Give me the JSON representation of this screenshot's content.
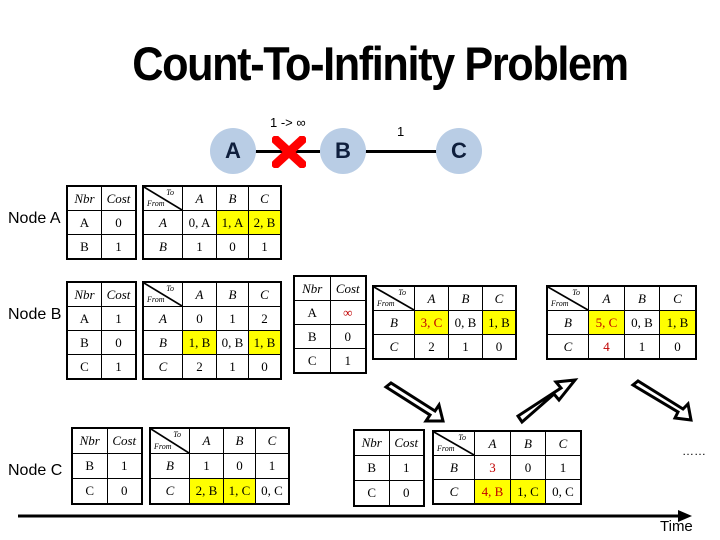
{
  "title": "Count-To-Infinity Problem",
  "topology": {
    "nodes": [
      {
        "id": "A",
        "label": "A"
      },
      {
        "id": "B",
        "label": "B"
      },
      {
        "id": "C",
        "label": "C"
      }
    ],
    "edges": [
      {
        "from": "A",
        "to": "B",
        "label": "1 -> ∞",
        "broken": true
      },
      {
        "from": "B",
        "to": "C",
        "label": "1",
        "broken": false
      }
    ],
    "node_color": "#b9cde5",
    "break_color": "#ff0000"
  },
  "node_labels": {
    "a": "Node A",
    "b": "Node B",
    "c": "Node C"
  },
  "table_headers": {
    "nbr": "Nbr",
    "cost": "Cost",
    "to": "To",
    "from": "From",
    "cols": [
      "A",
      "B",
      "C"
    ]
  },
  "tables": {
    "a1": {
      "nbr": [
        [
          "A",
          "0"
        ],
        [
          "B",
          "1"
        ]
      ],
      "dv": [
        {
          "from": "A",
          "cells": [
            {
              "v": "0, A"
            },
            {
              "v": "1, A",
              "hl": true
            },
            {
              "v": "2, B",
              "hl": true
            }
          ]
        },
        {
          "from": "B",
          "cells": [
            {
              "v": "1"
            },
            {
              "v": "0"
            },
            {
              "v": "1"
            }
          ]
        }
      ]
    },
    "b1": {
      "nbr": [
        [
          "A",
          "1"
        ],
        [
          "B",
          "0"
        ],
        [
          "C",
          "1"
        ]
      ],
      "dv": [
        {
          "from": "A",
          "cells": [
            {
              "v": "0"
            },
            {
              "v": "1"
            },
            {
              "v": "2"
            }
          ]
        },
        {
          "from": "B",
          "cells": [
            {
              "v": "1, B",
              "hl": true
            },
            {
              "v": "0, B"
            },
            {
              "v": "1, B",
              "hl": true
            }
          ]
        },
        {
          "from": "C",
          "cells": [
            {
              "v": "2"
            },
            {
              "v": "1"
            },
            {
              "v": "0"
            }
          ]
        }
      ]
    },
    "c1": {
      "nbr": [
        [
          "B",
          "1"
        ],
        [
          "C",
          "0"
        ]
      ],
      "dv": [
        {
          "from": "B",
          "cells": [
            {
              "v": "1"
            },
            {
              "v": "0"
            },
            {
              "v": "1"
            }
          ]
        },
        {
          "from": "C",
          "cells": [
            {
              "v": "2, B",
              "hl": true
            },
            {
              "v": "1, C",
              "hl": true
            },
            {
              "v": "0, C"
            }
          ]
        }
      ]
    },
    "b2": {
      "nbr": [
        [
          "A",
          "∞",
          "red"
        ],
        [
          "B",
          "0"
        ],
        [
          "C",
          "1"
        ]
      ],
      "dv": [
        {
          "from": "B",
          "cells": [
            {
              "v": "3, C",
              "hl": true,
              "red": true
            },
            {
              "v": "0, B"
            },
            {
              "v": "1, B",
              "hl": true
            }
          ]
        },
        {
          "from": "C",
          "cells": [
            {
              "v": "2"
            },
            {
              "v": "1"
            },
            {
              "v": "0"
            }
          ]
        }
      ]
    },
    "c2": {
      "nbr": [
        [
          "B",
          "1"
        ],
        [
          "C",
          "0"
        ]
      ],
      "dv": [
        {
          "from": "B",
          "cells": [
            {
              "v": "3",
              "red": true
            },
            {
              "v": "0"
            },
            {
              "v": "1"
            }
          ]
        },
        {
          "from": "C",
          "cells": [
            {
              "v": "4, B",
              "hl": true,
              "red": true
            },
            {
              "v": "1, C",
              "hl": true
            },
            {
              "v": "0, C"
            }
          ]
        }
      ]
    },
    "b3": {
      "dv": [
        {
          "from": "B",
          "cells": [
            {
              "v": "5, C",
              "hl": true,
              "red": true
            },
            {
              "v": "0, B"
            },
            {
              "v": "1, B",
              "hl": true
            }
          ]
        },
        {
          "from": "C",
          "cells": [
            {
              "v": "4",
              "red": true
            },
            {
              "v": "1"
            },
            {
              "v": "0"
            }
          ]
        }
      ]
    }
  },
  "ellipsis": "……",
  "time_label": "Time",
  "colors": {
    "highlight": "#ffff00",
    "changed_text": "#c00000"
  }
}
